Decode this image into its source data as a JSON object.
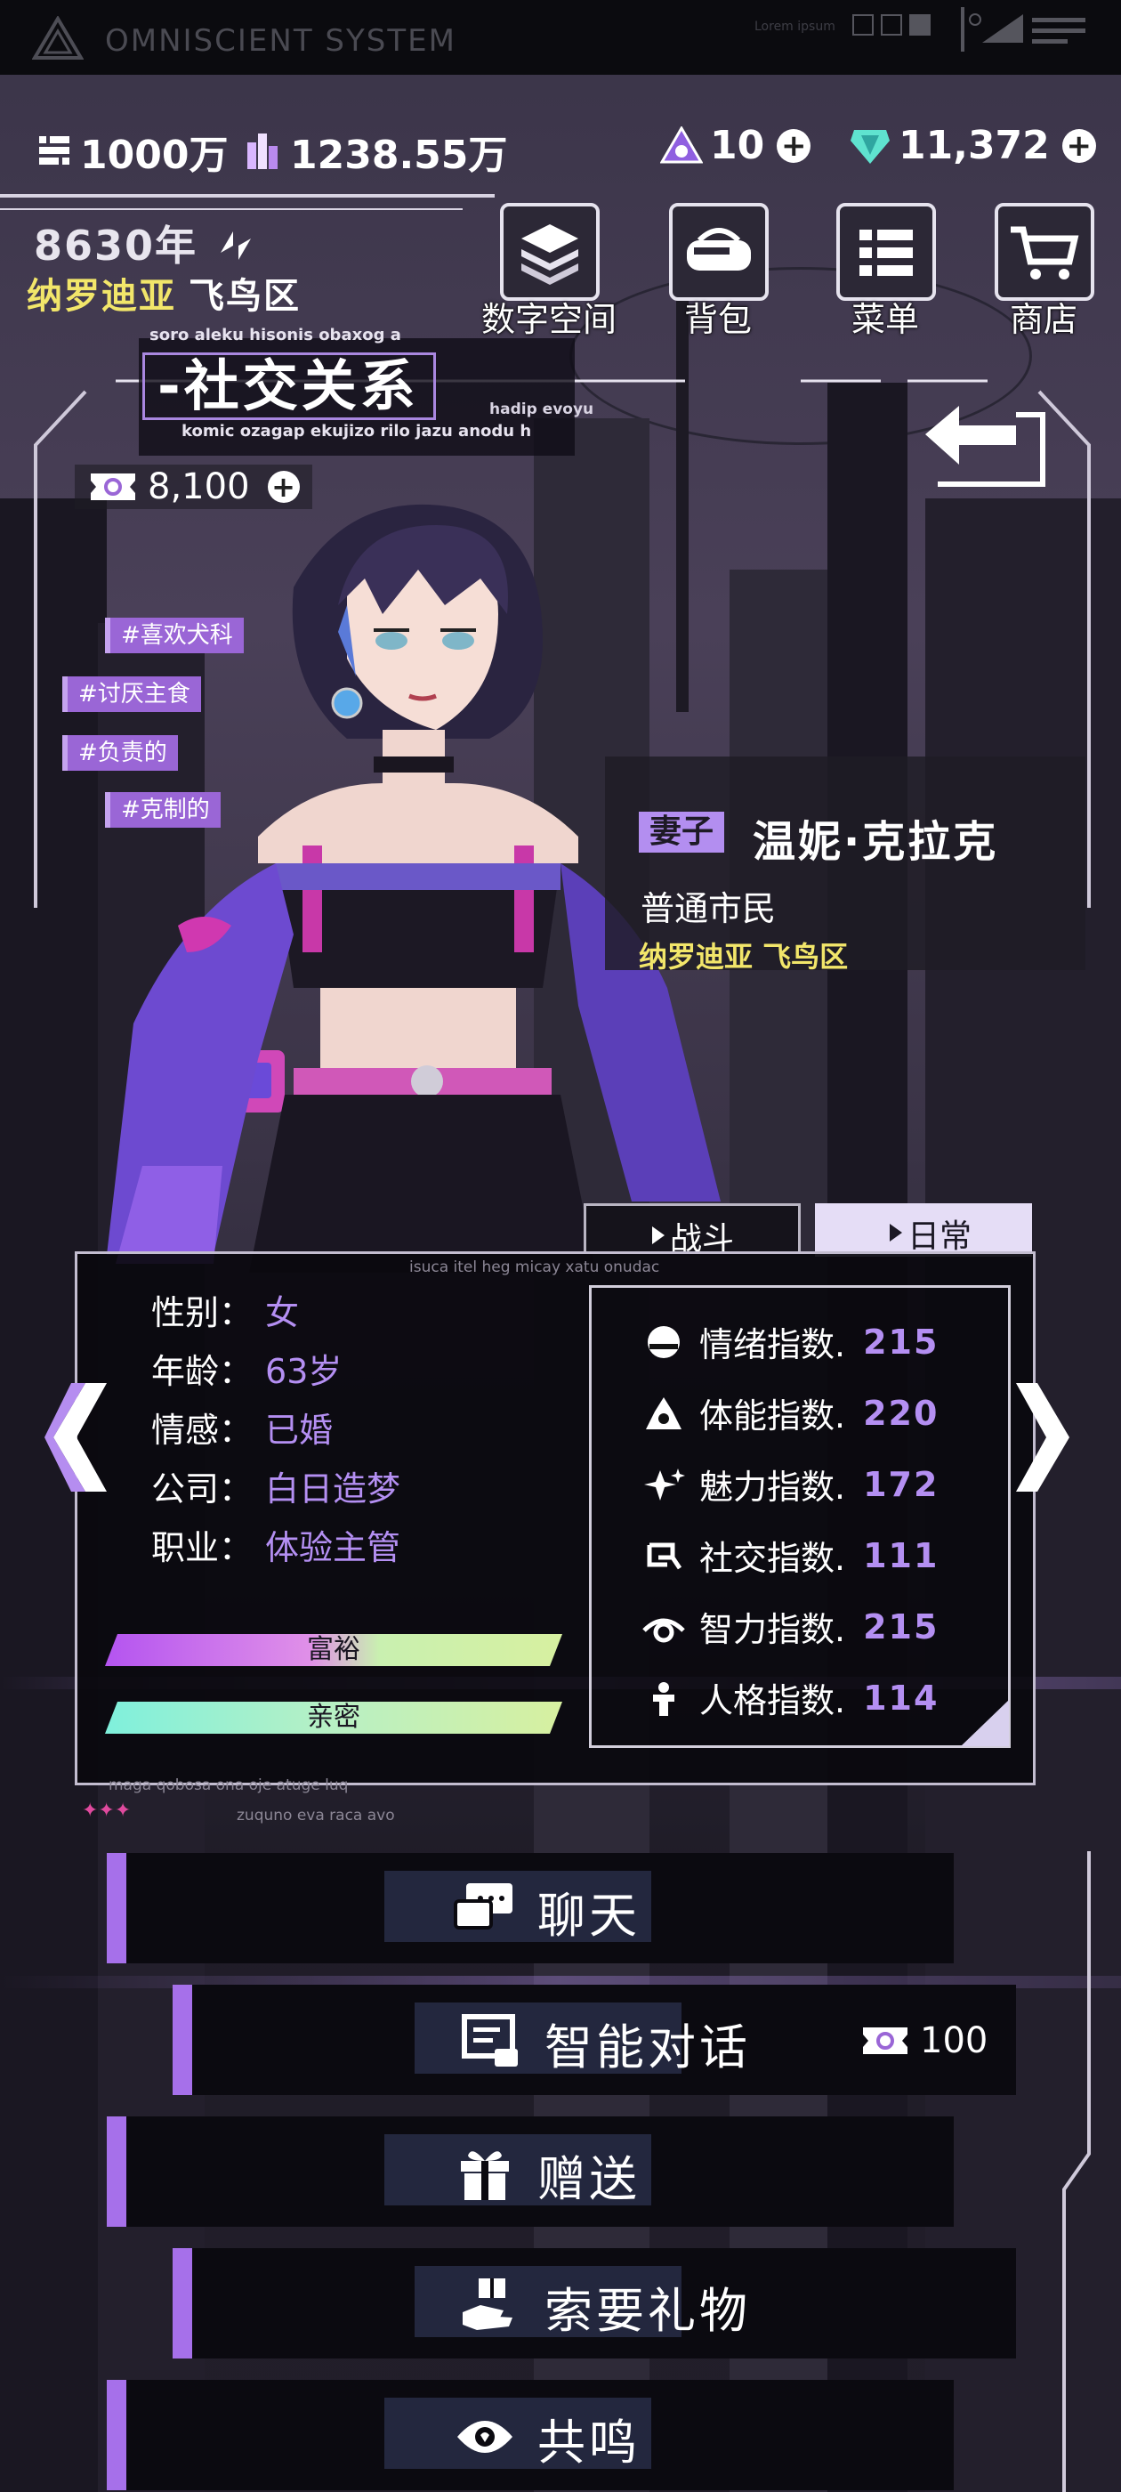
{
  "system": {
    "title": "OMNISCIENT SYSTEM",
    "small_text": "Lorem ipsum"
  },
  "currencies": {
    "gold": "1000万",
    "crystal": "1238.55万",
    "token": "10",
    "gem": "11,372"
  },
  "world": {
    "year": "8630年",
    "district_a": "纳罗迪亚",
    "district_b": "飞鸟区"
  },
  "menu": [
    {
      "label": "数字空间",
      "icon": "layers-icon"
    },
    {
      "label": "背包",
      "icon": "bag-icon"
    },
    {
      "label": "菜单",
      "icon": "list-icon"
    },
    {
      "label": "商店",
      "icon": "cart-icon"
    }
  ],
  "page": {
    "title": "-社交关系",
    "deco_1": "soro aleku hisonis obaxog a",
    "deco_2": "komic ozagap ekujizo rilo jazu anodu h",
    "deco_3": "hadip evoyu"
  },
  "coins": {
    "value": "8,100"
  },
  "tags": [
    "#喜欢犬科",
    "#讨厌主食",
    "#负责的",
    "#克制的"
  ],
  "character": {
    "role": "妻子",
    "name": "温妮·克拉克",
    "status": "普通市民",
    "location": "纳罗迪亚 飞鸟区"
  },
  "tabs": {
    "fight": "战斗",
    "daily": "日常"
  },
  "panel_deco": {
    "top": "isuca itel heg micay xatu onudac",
    "bottom_1": "maga qobosa ona oje atuge luq",
    "bottom_2": "zuquno eva raca avo"
  },
  "profile": [
    {
      "label": "性别：",
      "value": "女"
    },
    {
      "label": "年龄：",
      "value": "63岁"
    },
    {
      "label": "情感：",
      "value": "已婚"
    },
    {
      "label": "公司：",
      "value": "白日造梦"
    },
    {
      "label": "职业：",
      "value": "体验主管"
    }
  ],
  "bars": {
    "wealth": "富裕",
    "intimacy": "亲密"
  },
  "stats": [
    {
      "label": "情绪指数.",
      "value": "215",
      "icon": "mood-icon"
    },
    {
      "label": "体能指数.",
      "value": "220",
      "icon": "stamina-icon"
    },
    {
      "label": "魅力指数.",
      "value": "172",
      "icon": "charm-icon"
    },
    {
      "label": "社交指数.",
      "value": "111",
      "icon": "social-icon"
    },
    {
      "label": "智力指数.",
      "value": "215",
      "icon": "intellect-icon"
    },
    {
      "label": "人格指数.",
      "value": "114",
      "icon": "personality-icon"
    }
  ],
  "actions": [
    {
      "label": "聊天",
      "icon": "chat-icon"
    },
    {
      "label": "智能对话",
      "icon": "ai-dialog-icon",
      "cost": "100"
    },
    {
      "label": "赠送",
      "icon": "gift-icon"
    },
    {
      "label": "索要礼物",
      "icon": "request-gift-icon"
    },
    {
      "label": "共鸣",
      "icon": "resonance-icon"
    }
  ],
  "colors": {
    "accent": "#a670ea",
    "yellow": "#f2e66a",
    "stat_value": "#b48ff2"
  }
}
